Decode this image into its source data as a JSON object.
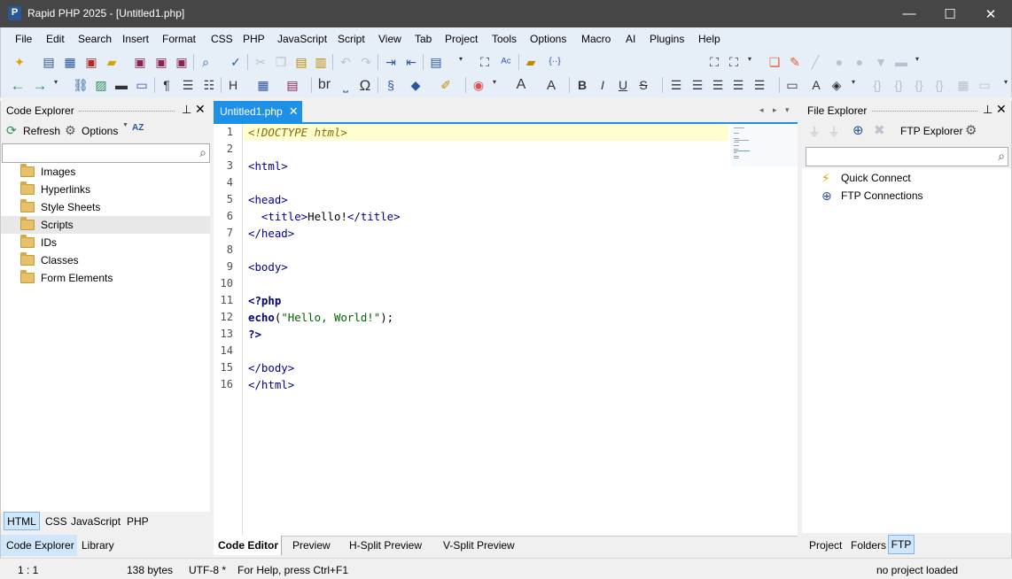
{
  "window": {
    "title": "Rapid PHP 2025 - [Untitled1.php]",
    "app_icon": "P",
    "minimize": "—",
    "maximize": "☐",
    "close": "✕"
  },
  "menu": [
    "File",
    "Edit",
    "Search",
    "Insert",
    "Format",
    "CSS",
    "PHP",
    "JavaScript",
    "Script",
    "View",
    "Tab",
    "Project",
    "Tools",
    "Options",
    "Macro",
    "AI",
    "Plugins",
    "Help"
  ],
  "toolbar": {
    "heading_button": "H",
    "br_button": "br",
    "omega_button": "Ω",
    "font_size_button": "A",
    "bold": "B",
    "italic": "I",
    "underline": "U",
    "strike": "S",
    "code_snippet": "{··}"
  },
  "code_explorer": {
    "title": "Code Explorer",
    "refresh": "Refresh",
    "options": "Options",
    "sort": "AZ",
    "items": [
      "Images",
      "Hyperlinks",
      "Style Sheets",
      "Scripts",
      "IDs",
      "Classes",
      "Form Elements"
    ],
    "selected_index": 3,
    "lang_tabs": [
      "HTML",
      "CSS",
      "JavaScript",
      "PHP"
    ],
    "bottom_tabs": [
      "Code Explorer",
      "Library"
    ]
  },
  "editor": {
    "tab": "Untitled1.php",
    "tab_close": "✕",
    "line_numbers": [
      "1",
      "2",
      "3",
      "4",
      "5",
      "6",
      "7",
      "8",
      "9",
      "10",
      "11",
      "12",
      "13",
      "14",
      "15",
      "16"
    ],
    "lines": {
      "l1": "<!DOCTYPE html>",
      "l3": "<html>",
      "l5": "<head>",
      "l6a": "  <title>",
      "l6b": "Hello!",
      "l6c": "</title>",
      "l7": "</head>",
      "l9": "<body>",
      "l11": "<?php",
      "l12a": "echo",
      "l12b": "(",
      "l12c": "\"Hello, World!\"",
      "l12d": ");",
      "l13": "?>",
      "l15": "</body>",
      "l16": "</html>"
    },
    "view_tabs": [
      "Code Editor",
      "Preview",
      "H-Split Preview",
      "V-Split Preview"
    ]
  },
  "file_explorer": {
    "title": "File Explorer",
    "ftp_explorer": "FTP Explorer",
    "items": [
      "Quick Connect",
      "FTP Connections"
    ],
    "bottom_tabs": [
      "Project",
      "Folders",
      "FTP"
    ]
  },
  "status": {
    "position": "1 : 1",
    "size": "138 bytes",
    "encoding": "UTF-8 *",
    "help": "For Help, press Ctrl+F1",
    "project": "no project loaded"
  }
}
